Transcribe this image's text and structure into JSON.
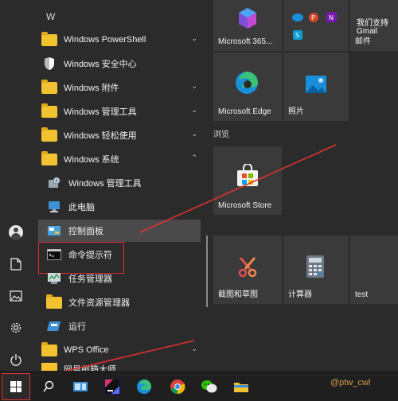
{
  "letter": "W",
  "apps": [
    {
      "label": "Windows PowerShell",
      "icon": "folder-icon",
      "chev": "⌄"
    },
    {
      "label": "Windows 安全中心",
      "icon": "shield-icon"
    },
    {
      "label": "Windows 附件",
      "icon": "folder-icon",
      "chev": "⌄"
    },
    {
      "label": "Windows 管理工具",
      "icon": "folder-icon",
      "chev": "⌄"
    },
    {
      "label": "Windows 轻松使用",
      "icon": "folder-icon",
      "chev": "⌄"
    },
    {
      "label": "Windows 系统",
      "icon": "folder-icon",
      "chev": "⌃"
    },
    {
      "label": "Windows 管理工具",
      "icon": "admin-tools-icon"
    },
    {
      "label": "此电脑",
      "icon": "this-pc-icon"
    },
    {
      "label": "控制面板",
      "icon": "control-panel-icon"
    },
    {
      "label": "命令提示符",
      "icon": "cmd-icon"
    },
    {
      "label": "任务管理器",
      "icon": "task-manager-icon"
    },
    {
      "label": "文件资源管理器",
      "icon": "file-explorer-icon"
    },
    {
      "label": "运行",
      "icon": "run-icon"
    },
    {
      "label": "WPS Office",
      "icon": "folder-icon",
      "chev": "⌄"
    },
    {
      "label": "网易邮箱大师",
      "icon": "folder-icon"
    }
  ],
  "tiles": {
    "microsoft365": "Microsoft 365...",
    "mail_line1": "我们支持",
    "mail_line2": "Gmail",
    "mail": "邮件",
    "edge": "Microsoft Edge",
    "photos": "照片",
    "browse_section": "浏览",
    "store": "Microsoft Store",
    "snip": "截图和草图",
    "calculator": "计算器",
    "test": "test"
  },
  "watermark": "@ptw_cwl",
  "colors": {
    "accent_red": "#e03030",
    "folder_yellow": "#f3c22f",
    "edge_blue": "#1a8fd9",
    "store_bg": "#3a3a3a"
  }
}
